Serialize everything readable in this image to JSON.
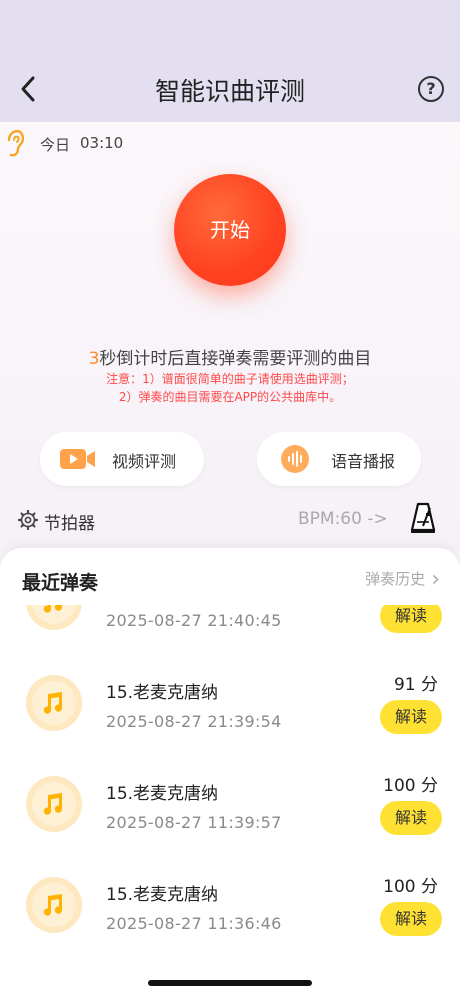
{
  "header": {
    "title": "智能识曲评测",
    "help_glyph": "?"
  },
  "today": {
    "label": "今日",
    "time": "03:10"
  },
  "start_button": "开始",
  "instructions": {
    "countdown_number": "3",
    "countdown_text": "秒倒计时后直接弹奏需要评测的曲目",
    "note_line1": "注意：1）谱面很简单的曲子请使用选曲评测；",
    "note_line2": "2）弹奏的曲目需要在APP的公共曲库中。"
  },
  "actions": {
    "video_label": "视频评测",
    "voice_label": "语音播报"
  },
  "metronome": {
    "label": "节拍器",
    "bpm": "BPM:60 ->"
  },
  "recent": {
    "title": "最近弹奏",
    "history_label": "弹奏历史",
    "history_chevron": "›",
    "items": [
      {
        "title": "",
        "time": "2025-08-27 21:40:45",
        "score": "",
        "read_label": "解读"
      },
      {
        "title": "15.老麦克唐纳",
        "time": "2025-08-27 21:39:54",
        "score": "91 分",
        "read_label": "解读"
      },
      {
        "title": "15.老麦克唐纳",
        "time": "2025-08-27 11:39:57",
        "score": "100 分",
        "read_label": "解读"
      },
      {
        "title": "15.老麦克唐纳",
        "time": "2025-08-27 11:36:46",
        "score": "100 分",
        "read_label": "解读"
      }
    ]
  },
  "colors": {
    "accent_orange": "#ff4222",
    "note_red": "#ff4a4a",
    "read_button_yellow": "#ffe134",
    "music_icon_orange": "#ffb300",
    "nav_background": "#e4dff0"
  },
  "icons": {
    "back": "chevron-left-icon",
    "help": "help-circle-icon",
    "ear": "ear-icon",
    "video": "video-camera-icon",
    "voice": "voice-wave-icon",
    "gear": "gear-icon",
    "metronome": "metronome-icon",
    "music": "music-note-icon"
  }
}
